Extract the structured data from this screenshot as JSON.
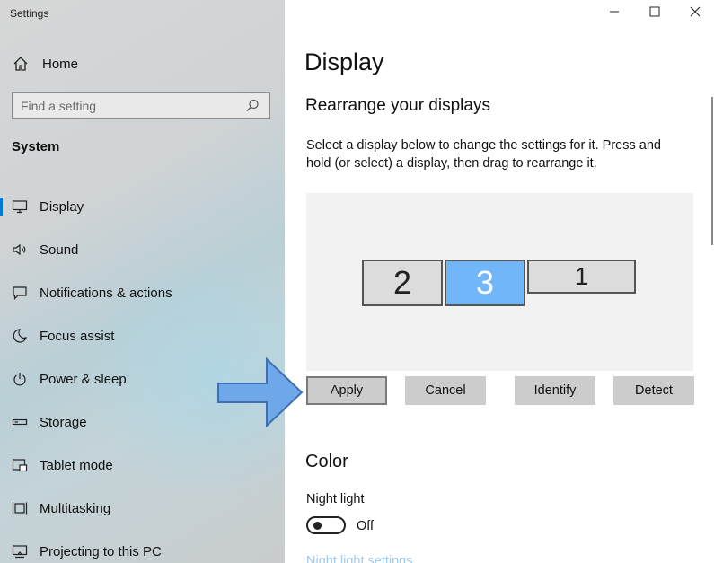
{
  "window": {
    "title": "Settings",
    "controls": [
      "minimize-icon",
      "maximize-icon",
      "close-icon"
    ]
  },
  "sidebar": {
    "home_label": "Home",
    "search": {
      "placeholder": "Find a setting",
      "value": ""
    },
    "section_label": "System",
    "items": [
      {
        "label": "Display",
        "icon": "monitor-icon",
        "selected": true
      },
      {
        "label": "Sound",
        "icon": "speaker-icon"
      },
      {
        "label": "Notifications & actions",
        "icon": "notification-icon"
      },
      {
        "label": "Focus assist",
        "icon": "moon-icon"
      },
      {
        "label": "Power & sleep",
        "icon": "power-icon"
      },
      {
        "label": "Storage",
        "icon": "storage-icon"
      },
      {
        "label": "Tablet mode",
        "icon": "tablet-icon"
      },
      {
        "label": "Multitasking",
        "icon": "multitasking-icon"
      },
      {
        "label": "Projecting to this PC",
        "icon": "projecting-icon"
      }
    ]
  },
  "main": {
    "title": "Display",
    "rearrange_title": "Rearrange your displays",
    "description": "Select a display below to change the settings for it. Press and hold (or select) a display, then drag to rearrange it.",
    "displays": [
      {
        "number": "2",
        "selected": false
      },
      {
        "number": "3",
        "selected": true
      },
      {
        "number": "1",
        "selected": false
      }
    ],
    "buttons": {
      "apply": "Apply",
      "cancel": "Cancel",
      "identify": "Identify",
      "detect": "Detect"
    },
    "color_title": "Color",
    "night_light_label": "Night light",
    "night_light_state": "Off",
    "night_light_link": "Night light settings"
  },
  "colors": {
    "accent": "#0078d7",
    "selected_display": "#71b6f9",
    "annotation_arrow": "#6fa8e8"
  }
}
